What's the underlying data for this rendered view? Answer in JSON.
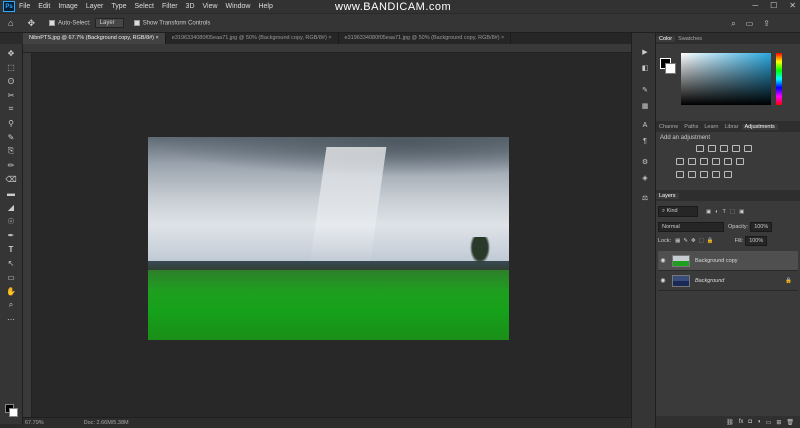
{
  "watermark": "www.BANDICAM.com",
  "menu": [
    "File",
    "Edit",
    "Image",
    "Layer",
    "Type",
    "Select",
    "Filter",
    "3D",
    "View",
    "Window",
    "Help"
  ],
  "app_logo": "Ps",
  "window_controls": [
    "─",
    "☐",
    "✕"
  ],
  "options": {
    "auto_select_label": "Auto-Select:",
    "auto_select_value": "Layer",
    "show_transform_label": "Show Transform Controls"
  },
  "tabs": [
    "NibnPTS.jpg @ 67.7% (Background copy, RGB/8#) ×",
    "e3196334080f05eaa71.jpg @ 50% (Background copy, RGB/8#) ×",
    "e3196334080f05eaa71.jpg @ 50% (Background copy, RGB/8#) ×"
  ],
  "panels": {
    "color_tabs": [
      "Color",
      "Swatches"
    ],
    "adj_tabs": [
      "Channe",
      "Paths",
      "Learn",
      "Librar",
      "Adjustments"
    ],
    "adj_label": "Add an adjustment",
    "layers_tab": "Layers",
    "kind_label": "Kind",
    "blend_mode": "Normal",
    "opacity_label": "Opacity:",
    "opacity_value": "100%",
    "lock_label": "Lock:",
    "fill_label": "Fill:",
    "fill_value": "100%",
    "layers": [
      {
        "name": "Background copy",
        "selected": true
      },
      {
        "name": "Background",
        "selected": false
      }
    ]
  },
  "status": {
    "zoom": "67.79%",
    "doc": "Doc: 2.66M/5.38M"
  },
  "colors": {
    "accent": "#31a8ff",
    "foreground": "#000000",
    "background": "#ffffff"
  },
  "icons": {
    "home": "⌂",
    "move": "✥",
    "toolbar": [
      "✥",
      "⬚",
      "ʘ",
      "✂",
      "⌗",
      "⚲",
      "✎",
      "⎘",
      "✏",
      "⌫",
      "▬",
      "◢",
      "☉",
      "✒",
      "T",
      "↖",
      "▭",
      "✋",
      "⌕",
      "⋯"
    ]
  }
}
